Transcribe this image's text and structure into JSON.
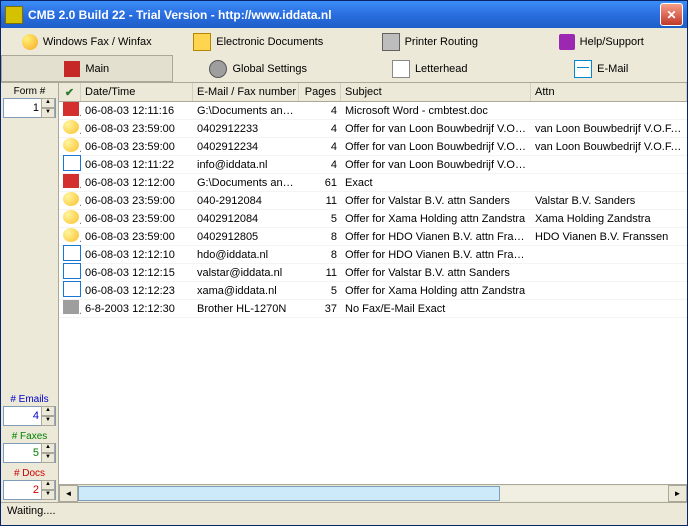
{
  "window": {
    "title": "CMB 2.0 Build 22 - Trial Version - http://www.iddata.nl"
  },
  "toolbar1": {
    "fax": "Windows Fax / Winfax",
    "edoc": "Electronic Documents",
    "printer": "Printer Routing",
    "help": "Help/Support"
  },
  "toolbar2": {
    "main": "Main",
    "global": "Global Settings",
    "letterhead": "Letterhead",
    "email": "E-Mail"
  },
  "sidebar": {
    "form_label": "Form #",
    "form_value": "1",
    "emails_label": "# Emails",
    "emails_value": "4",
    "faxes_label": "# Faxes",
    "faxes_value": "5",
    "docs_label": "# Docs",
    "docs_value": "2"
  },
  "columns": {
    "datetime": "Date/Time",
    "email": "E-Mail / Fax number ...",
    "pages": "Pages",
    "subject": "Subject",
    "attn": "Attn"
  },
  "rows": [
    {
      "icon": "pdf",
      "dt": "06-08-03 12:11:16",
      "em": "G:\\Documents and S...",
      "pg": "4",
      "subj": "Microsoft Word - cmbtest.doc",
      "attn": ""
    },
    {
      "icon": "ball",
      "dt": "06-08-03 23:59:00",
      "em": "0402912233",
      "pg": "4",
      "subj": "Offer for van Loon Bouwbedrijf V.O.F. ...",
      "attn": "van Loon Bouwbedrijf V.O.F. dhr. J.I"
    },
    {
      "icon": "ball",
      "dt": "06-08-03 23:59:00",
      "em": "0402912234",
      "pg": "4",
      "subj": "Offer for van Loon Bouwbedrijf V.O.F. ...",
      "attn": "van Loon Bouwbedrijf V.O.F. dhr. J.I"
    },
    {
      "icon": "blue",
      "dt": "06-08-03 12:11:22",
      "em": "info@iddata.nl",
      "pg": "4",
      "subj": "Offer for van Loon Bouwbedrijf V.O.F. ...",
      "attn": ""
    },
    {
      "icon": "pdf",
      "dt": "06-08-03 12:12:00",
      "em": "G:\\Documents and S...",
      "pg": "61",
      "subj": "Exact",
      "attn": ""
    },
    {
      "icon": "ball",
      "dt": "06-08-03 23:59:00",
      "em": "040-2912084",
      "pg": "11",
      "subj": "Offer for Valstar B.V. attn Sanders",
      "attn": "Valstar B.V. Sanders"
    },
    {
      "icon": "ball",
      "dt": "06-08-03 23:59:00",
      "em": "0402912084",
      "pg": "5",
      "subj": "Offer for Xama Holding attn Zandstra",
      "attn": "Xama Holding Zandstra"
    },
    {
      "icon": "ball",
      "dt": "06-08-03 23:59:00",
      "em": "0402912805",
      "pg": "8",
      "subj": "Offer for HDO Vianen B.V. attn Franssen",
      "attn": "HDO Vianen B.V. Franssen"
    },
    {
      "icon": "blue",
      "dt": "06-08-03 12:12:10",
      "em": "hdo@iddata.nl",
      "pg": "8",
      "subj": "Offer for HDO Vianen B.V. attn Franssen",
      "attn": ""
    },
    {
      "icon": "blue",
      "dt": "06-08-03 12:12:15",
      "em": "valstar@iddata.nl",
      "pg": "11",
      "subj": "Offer for Valstar B.V. attn Sanders",
      "attn": ""
    },
    {
      "icon": "blue",
      "dt": "06-08-03 12:12:23",
      "em": "xama@iddata.nl",
      "pg": "5",
      "subj": "Offer for Xama Holding attn Zandstra",
      "attn": ""
    },
    {
      "icon": "prn",
      "dt": "6-8-2003 12:12:30",
      "em": "Brother HL-1270N",
      "pg": "37",
      "subj": "No Fax/E-Mail Exact",
      "attn": ""
    }
  ],
  "status": "Waiting...."
}
